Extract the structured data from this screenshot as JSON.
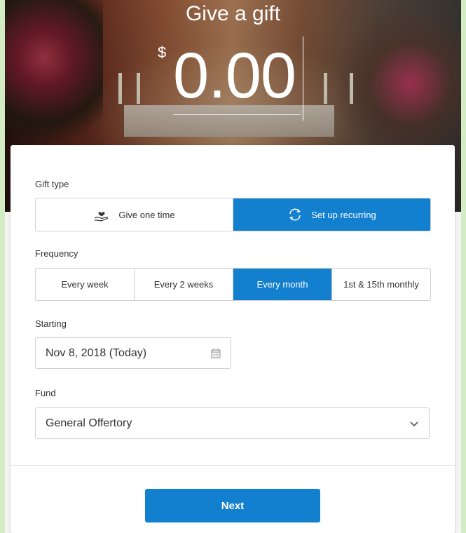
{
  "header": {
    "title": "Give a gift",
    "currency_symbol": "$",
    "amount": "0.00"
  },
  "form": {
    "gift_type": {
      "label": "Gift type",
      "options": [
        {
          "label": "Give one time",
          "icon": "hand-heart-icon",
          "selected": false
        },
        {
          "label": "Set up recurring",
          "icon": "recurring-arrows-icon",
          "selected": true
        }
      ]
    },
    "frequency": {
      "label": "Frequency",
      "options": [
        {
          "label": "Every week",
          "selected": false
        },
        {
          "label": "Every 2 weeks",
          "selected": false
        },
        {
          "label": "Every month",
          "selected": true
        },
        {
          "label": "1st & 15th monthly",
          "selected": false
        }
      ]
    },
    "starting": {
      "label": "Starting",
      "value": "Nov 8, 2018 (Today)",
      "icon": "calendar-icon"
    },
    "fund": {
      "label": "Fund",
      "value": "General Offertory",
      "icon": "chevron-down-icon"
    },
    "next_label": "Next"
  },
  "colors": {
    "accent": "#1380cf",
    "page_background": "#f4f4f4",
    "side_strip": "#d4ecc4"
  }
}
